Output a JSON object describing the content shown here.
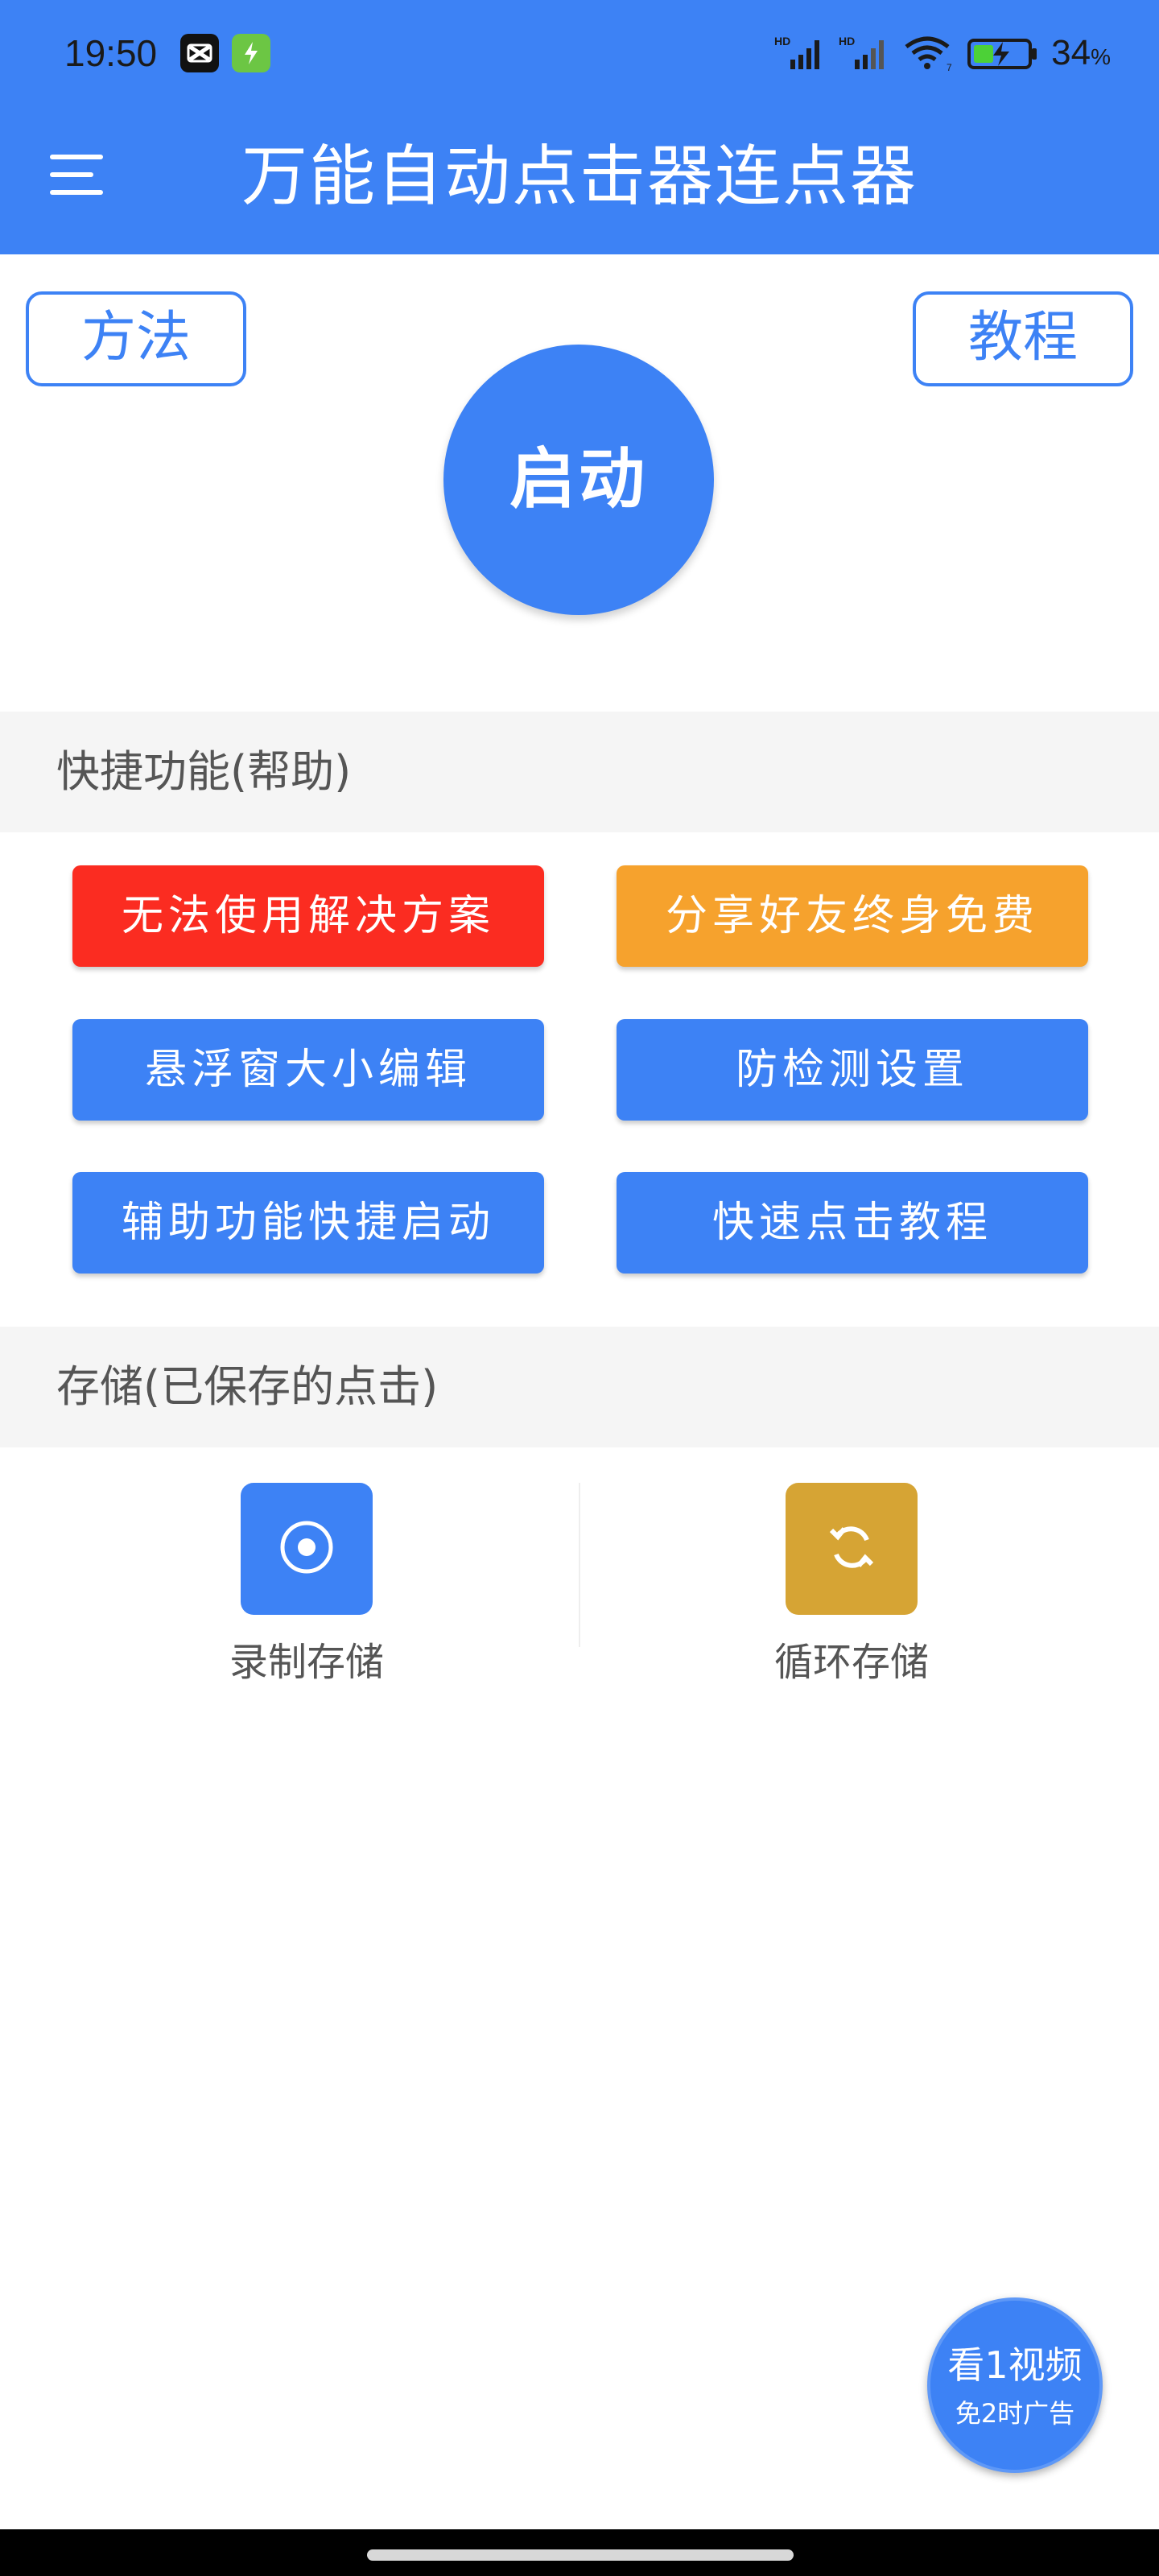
{
  "status_bar": {
    "time": "19:50",
    "battery": "34",
    "battery_unit": "%",
    "icons": [
      "capcut-icon",
      "battery-saver-app-icon",
      "hd-signal-icon",
      "hd-signal-icon",
      "wifi-icon",
      "battery-charging-icon"
    ]
  },
  "app_bar": {
    "title": "万能自动点击器连点器",
    "menu_icon": "hamburger-menu-icon"
  },
  "top_buttons": {
    "method": "方法",
    "tutorial": "教程",
    "start": "启动"
  },
  "quick_section": {
    "header": "快捷功能(帮助)",
    "buttons": [
      {
        "label": "无法使用解决方案",
        "color": "#fb2c21"
      },
      {
        "label": "分享好友终身免费",
        "color": "#f6a22d"
      },
      {
        "label": "悬浮窗大小编辑",
        "color": "#3d82f5"
      },
      {
        "label": "防检测设置",
        "color": "#3d82f5"
      },
      {
        "label": "辅助功能快捷启动",
        "color": "#3d82f5"
      },
      {
        "label": "快速点击教程",
        "color": "#3d82f5"
      }
    ]
  },
  "storage_section": {
    "header": "存储(已保存的点击)",
    "items": [
      {
        "label": "录制存储",
        "icon": "record-icon",
        "color": "#3d82f5"
      },
      {
        "label": "循环存储",
        "icon": "loop-icon",
        "color": "#d6a434"
      }
    ]
  },
  "ad_button": {
    "line1": "看1视频",
    "line2": "免2时广告"
  },
  "colors": {
    "primary": "#3d82f5",
    "danger": "#fb2c21",
    "warning": "#f6a22d",
    "gold": "#d6a434"
  }
}
